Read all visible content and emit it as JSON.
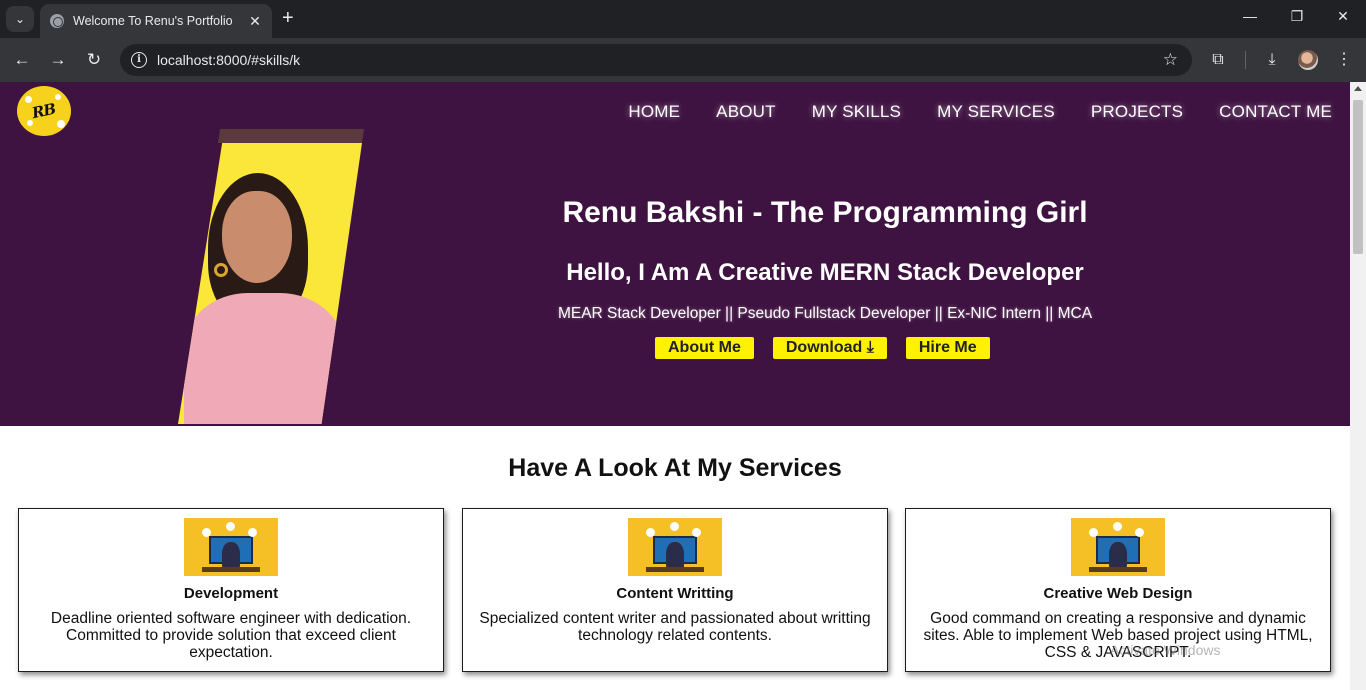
{
  "browser": {
    "tab_title": "Welcome To Renu's Portfolio",
    "url": "localhost:8000/#skills/k",
    "icons": {
      "tab_menu": "chevron-down-icon",
      "close_tab": "close-icon",
      "new_tab": "plus-icon",
      "back": "arrow-left-icon",
      "forward": "arrow-right-icon",
      "reload": "reload-icon",
      "site_info": "info-icon",
      "bookmark": "star-icon",
      "extensions": "puzzle-icon",
      "downloads": "download-icon",
      "profile": "avatar",
      "menu": "kebab-menu-icon"
    }
  },
  "site": {
    "logo_text": "RB",
    "nav": [
      "HOME",
      "ABOUT",
      "MY SKILLS",
      "MY SERVICES",
      "PROJECTS",
      "CONTACT ME"
    ],
    "hero": {
      "title": "Renu Bakshi - The Programming Girl",
      "subtitle": "Hello, I Am A Creative MERN Stack Developer",
      "tagline": "MEAR Stack Developer || Pseudo Fullstack Developer || Ex-NIC Intern || MCA",
      "buttons": {
        "about": "About Me",
        "download": "Download",
        "hire": "Hire Me"
      }
    },
    "services": {
      "title": "Have A Look At My Services",
      "cards": [
        {
          "title": "Development",
          "text": "Deadline oriented software engineer with dedication. Committed to provide solution that exceed client expectation."
        },
        {
          "title": "Content Writting",
          "text": "Specialized content writer and passionated about writting technology related contents."
        },
        {
          "title": "Creative Web Design",
          "text": "Good command on creating a responsive and dynamic sites. Able to implement Web based project using HTML, CSS & JAVASCRIPT."
        }
      ]
    },
    "watermark": "Activate Windows"
  },
  "colors": {
    "hero_bg": "#3f1341",
    "accent_yellow": "#fff200",
    "photo_frame": "#fae73a",
    "logo_bg": "#f7d21d"
  }
}
